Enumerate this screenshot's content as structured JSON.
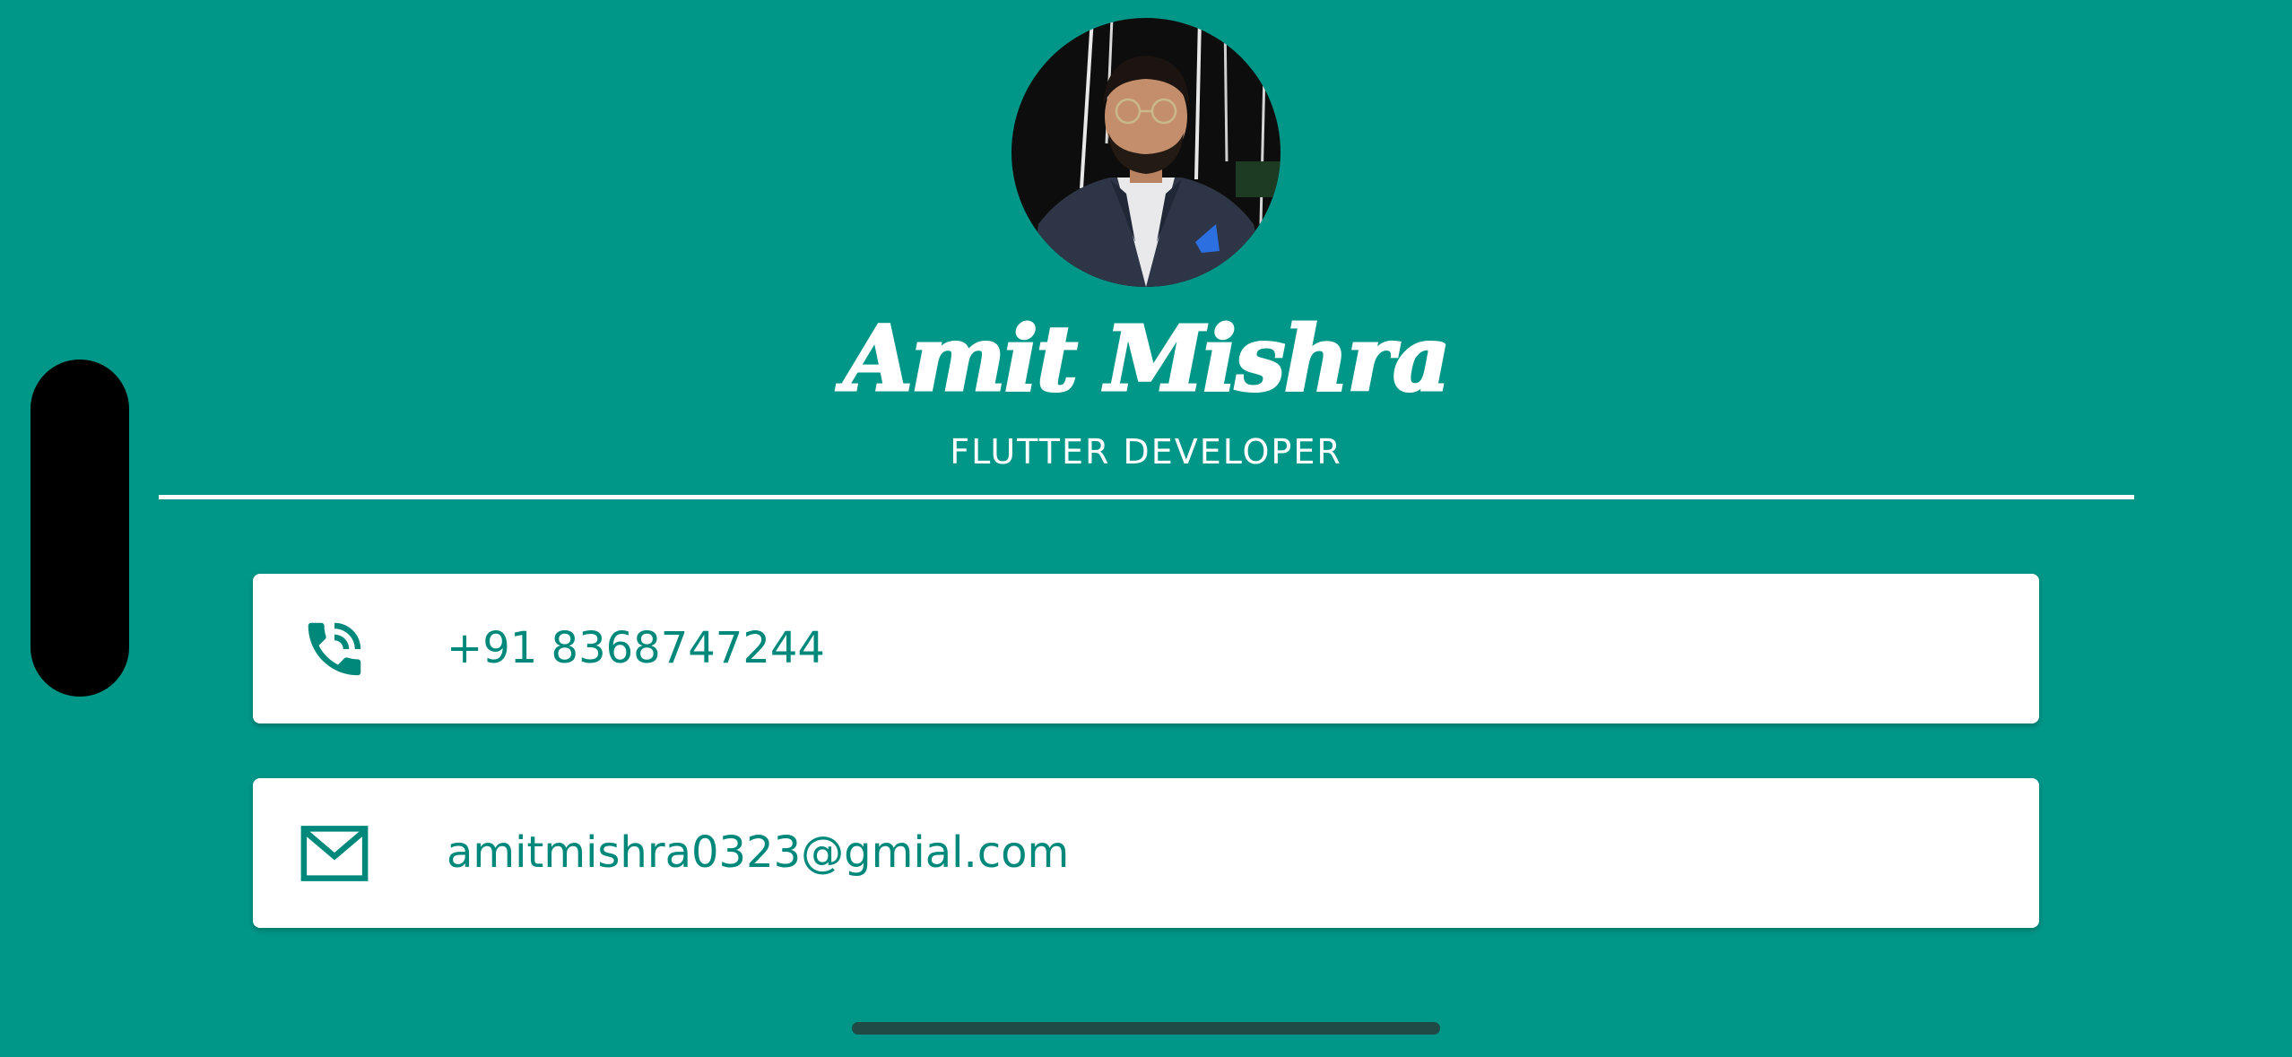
{
  "profile": {
    "name": "Amit Mishra",
    "title": "FLUTTER DEVELOPER",
    "avatar_description": "profile photo"
  },
  "contacts": {
    "phone": {
      "icon": "phone-icon",
      "value": "+91 8368747244"
    },
    "email": {
      "icon": "mail-icon",
      "value": "amitmishra0323@gmial.com"
    }
  },
  "colors": {
    "background": "#009688",
    "card": "#FFFFFF",
    "accent_text": "#00897B",
    "divider": "#FFFFFF"
  }
}
